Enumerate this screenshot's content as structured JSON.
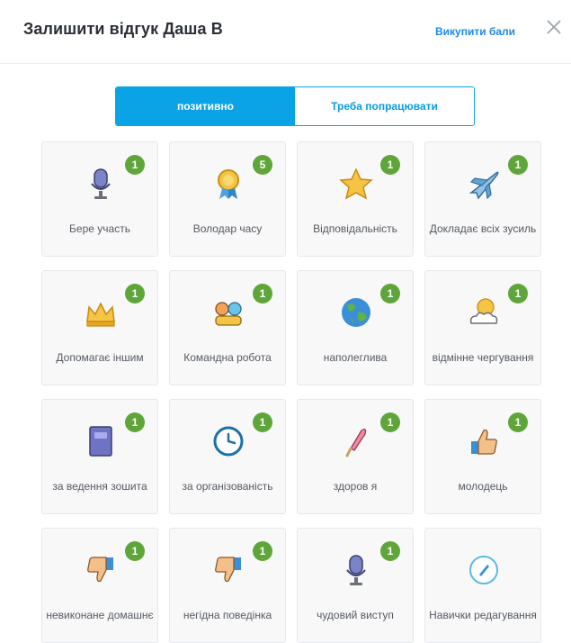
{
  "header": {
    "title": "Залишити відгук Даша В",
    "redeem_label": "Викупити бали"
  },
  "tabs": [
    {
      "label": "позитивно",
      "active": true
    },
    {
      "label": "Треба попрацювати",
      "active": false
    }
  ],
  "cards": [
    {
      "label": "Бере участь",
      "count": "1",
      "icon": "microphone-icon"
    },
    {
      "label": "Володар часу",
      "count": "5",
      "icon": "medal-icon"
    },
    {
      "label": "Відповідальність",
      "count": "1",
      "icon": "star-icon"
    },
    {
      "label": "Докладає всіх зусиль",
      "count": "1",
      "icon": "airplane-icon"
    },
    {
      "label": "Допомагає іншим",
      "count": "1",
      "icon": "crown-icon"
    },
    {
      "label": "Командна робота",
      "count": "1",
      "icon": "team-icon"
    },
    {
      "label": "наполеглива",
      "count": "1",
      "icon": "globe-icon"
    },
    {
      "label": "відмінне чергування",
      "count": "1",
      "icon": "weather-icon"
    },
    {
      "label": "за ведення зошита",
      "count": "1",
      "icon": "notebook-icon"
    },
    {
      "label": "за організованість",
      "count": "1",
      "icon": "clock-icon"
    },
    {
      "label": "здоров я",
      "count": "1",
      "icon": "ice-cream-icon"
    },
    {
      "label": "молодець",
      "count": "1",
      "icon": "thumbs-up-icon"
    },
    {
      "label": "невиконане домашнє",
      "count": "1",
      "icon": "thumbs-down-icon"
    },
    {
      "label": "негідна поведінка",
      "count": "1",
      "icon": "thumbs-down-icon"
    },
    {
      "label": "чудовий виступ",
      "count": "1",
      "icon": "microphone-icon"
    },
    {
      "label": "Навички редагування",
      "count": "",
      "icon": "pencil-circle-icon"
    }
  ]
}
